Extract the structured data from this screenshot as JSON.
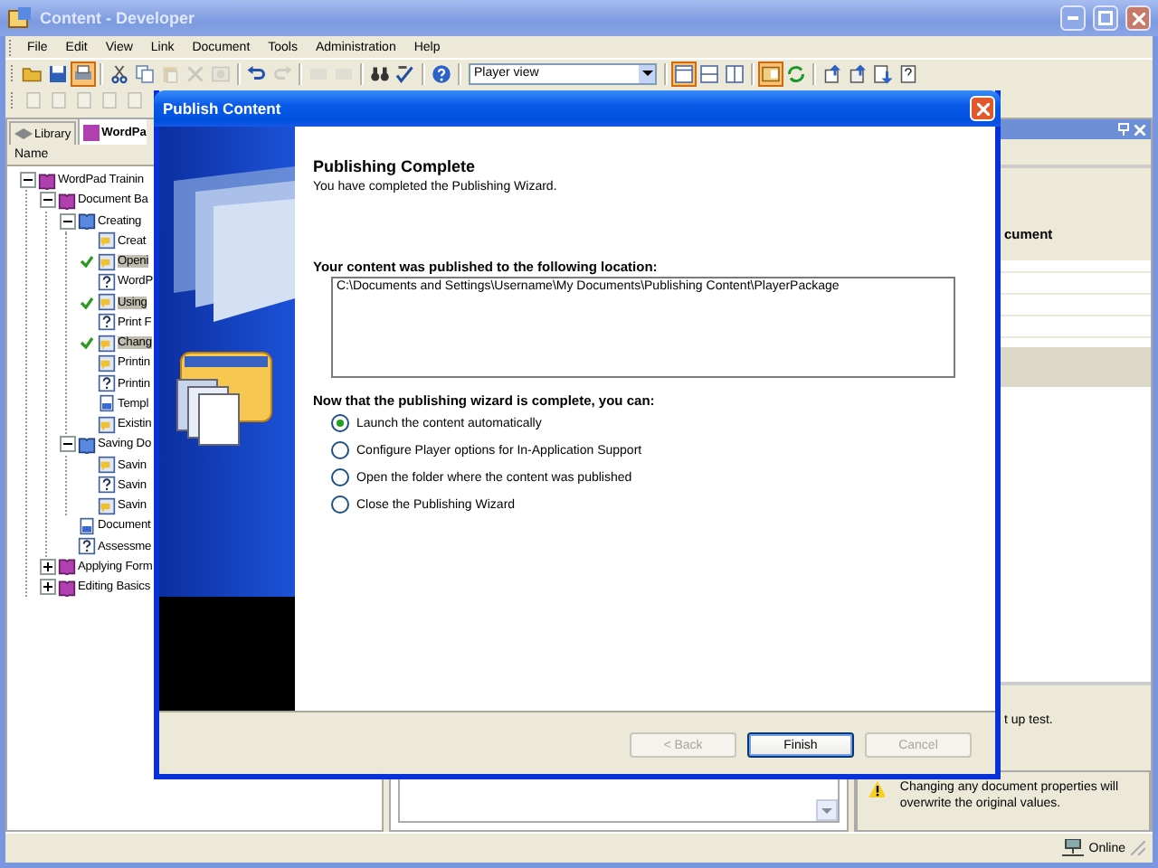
{
  "window": {
    "title": "Content - Developer"
  },
  "menu": [
    "File",
    "Edit",
    "View",
    "Link",
    "Document",
    "Tools",
    "Administration",
    "Help"
  ],
  "toolbar": [
    {
      "kind": "button",
      "pressed": false,
      "disabled": false
    },
    {
      "kind": "button",
      "pressed": false,
      "disabled": false
    },
    {
      "kind": "button",
      "pressed": true,
      "disabled": false
    },
    {
      "kind": "separator"
    },
    {
      "kind": "button",
      "pressed": false,
      "disabled": false
    },
    {
      "kind": "button",
      "pressed": false,
      "disabled": false
    },
    {
      "kind": "button",
      "pressed": false,
      "disabled": true
    },
    {
      "kind": "button",
      "pressed": false,
      "disabled": true
    },
    {
      "kind": "button",
      "pressed": false,
      "disabled": true
    },
    {
      "kind": "separator"
    },
    {
      "kind": "button",
      "pressed": false,
      "disabled": false
    },
    {
      "kind": "button",
      "pressed": false,
      "disabled": true
    },
    {
      "kind": "separator"
    },
    {
      "kind": "button",
      "pressed": false,
      "disabled": true
    },
    {
      "kind": "button",
      "pressed": false,
      "disabled": true
    },
    {
      "kind": "separator"
    },
    {
      "kind": "button",
      "pressed": false,
      "disabled": false
    },
    {
      "kind": "button",
      "pressed": false,
      "disabled": false
    },
    {
      "kind": "separator"
    },
    {
      "kind": "button",
      "pressed": false,
      "disabled": false
    },
    {
      "kind": "separator"
    },
    {
      "kind": "select",
      "value": "Player view"
    },
    {
      "kind": "separator"
    },
    {
      "kind": "button",
      "pressed": true,
      "disabled": false
    },
    {
      "kind": "button",
      "pressed": false,
      "disabled": false
    },
    {
      "kind": "button",
      "pressed": false,
      "disabled": false
    },
    {
      "kind": "separator"
    },
    {
      "kind": "button",
      "pressed": true,
      "disabled": false
    },
    {
      "kind": "button",
      "pressed": false,
      "disabled": false
    },
    {
      "kind": "separator"
    },
    {
      "kind": "button",
      "pressed": false,
      "disabled": false
    },
    {
      "kind": "button",
      "pressed": false,
      "disabled": false
    },
    {
      "kind": "button",
      "pressed": false,
      "disabled": false
    },
    {
      "kind": "button",
      "pressed": false,
      "disabled": false
    }
  ],
  "toolbar_2": [
    {
      "disabled": true
    },
    {
      "disabled": true
    },
    {
      "disabled": true
    },
    {
      "disabled": true
    },
    {
      "disabled": true
    }
  ],
  "tabs": [
    {
      "label": "Library",
      "selected": false
    },
    {
      "label": "WordPa",
      "selected": true
    }
  ],
  "tree": {
    "column": "Name",
    "items": [
      {
        "label": "WordPad Trainin",
        "kind": "book",
        "expanded": true,
        "children": [
          {
            "label": "Document Ba",
            "kind": "book",
            "expanded": true,
            "children": [
              {
                "label": "Creating",
                "kind": "chapter",
                "expanded": true,
                "children": [
                  {
                    "label": "Creat",
                    "kind": "topic",
                    "checked": false,
                    "selected": false
                  },
                  {
                    "label": "Openi",
                    "kind": "topic",
                    "checked": true,
                    "selected": true
                  },
                  {
                    "label": "WordP",
                    "kind": "question",
                    "checked": false,
                    "selected": false
                  },
                  {
                    "label": "Using",
                    "kind": "topic",
                    "checked": true,
                    "selected": true
                  },
                  {
                    "label": "Print F",
                    "kind": "question",
                    "checked": false,
                    "selected": false
                  },
                  {
                    "label": "Chang",
                    "kind": "topic",
                    "checked": true,
                    "selected": true
                  },
                  {
                    "label": "Printin",
                    "kind": "topic",
                    "checked": false,
                    "selected": false
                  },
                  {
                    "label": "Printin",
                    "kind": "question",
                    "checked": false,
                    "selected": false
                  },
                  {
                    "label": "Templ",
                    "kind": "document",
                    "checked": false,
                    "selected": false
                  },
                  {
                    "label": "Existin",
                    "kind": "topic",
                    "checked": false,
                    "selected": false
                  }
                ]
              },
              {
                "label": "Saving Do",
                "kind": "chapter",
                "expanded": true,
                "children": [
                  {
                    "label": "Savin",
                    "kind": "topic",
                    "checked": false,
                    "selected": false
                  },
                  {
                    "label": "Savin",
                    "kind": "question",
                    "checked": false,
                    "selected": false
                  },
                  {
                    "label": "Savin",
                    "kind": "topic",
                    "checked": false,
                    "selected": false
                  }
                ]
              },
              {
                "label": "Document",
                "kind": "document",
                "checked": false,
                "selected": false
              },
              {
                "label": "Assessme",
                "kind": "question",
                "checked": false,
                "selected": false
              }
            ]
          },
          {
            "label": "Applying Form",
            "kind": "book",
            "expanded": false
          },
          {
            "label": "Editing Basics",
            "kind": "book",
            "expanded": false
          }
        ]
      }
    ]
  },
  "right_panel": {
    "heading": "cument",
    "note": "t up test.",
    "warning": "Changing any document properties will overwrite the original values."
  },
  "dialog": {
    "title": "Publish Content",
    "heading": "Publishing Complete",
    "subtitle": "You have completed the Publishing Wizard.",
    "location_label": "Your content was published to the following location:",
    "location": "C:\\Documents and Settings\\Username\\My Documents\\Publishing Content\\PlayerPackage",
    "options_label": "Now that the publishing wizard is complete, you can:",
    "options": [
      {
        "label": "Launch the content automatically",
        "selected": true
      },
      {
        "label": "Configure Player options for In-Application Support",
        "selected": false
      },
      {
        "label": "Open the folder where the content was published",
        "selected": false
      },
      {
        "label": "Close the Publishing Wizard",
        "selected": false
      }
    ],
    "buttons": [
      {
        "label": "< Back",
        "disabled": true,
        "default": false
      },
      {
        "label": "Finish",
        "disabled": false,
        "default": true
      },
      {
        "label": "Cancel",
        "disabled": true,
        "default": false
      }
    ]
  },
  "status_bar": {
    "text": "Online"
  }
}
